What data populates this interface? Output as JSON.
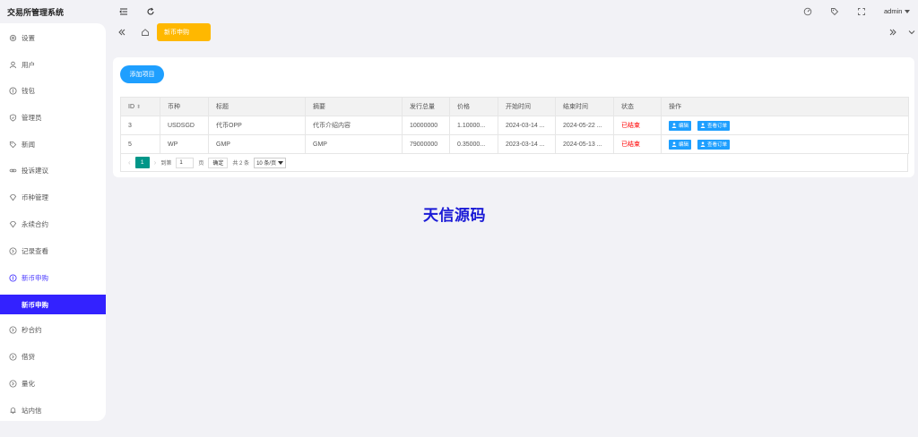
{
  "app": {
    "title": "交易所管理系统"
  },
  "sidebar": {
    "items": [
      {
        "label": "设置",
        "icon": "gear-icon"
      },
      {
        "label": "用户",
        "icon": "user-icon"
      },
      {
        "label": "钱包",
        "icon": "coin-icon"
      },
      {
        "label": "管理员",
        "icon": "shield-icon"
      },
      {
        "label": "新闻",
        "icon": "tag-icon"
      },
      {
        "label": "投诉建议",
        "icon": "link-icon"
      },
      {
        "label": "币种管理",
        "icon": "diamond-icon"
      },
      {
        "label": "永续合约",
        "icon": "diamond-icon"
      },
      {
        "label": "记录查看",
        "icon": "circle-arrow-icon"
      },
      {
        "label": "新币申购",
        "icon": "coin-icon"
      },
      {
        "label": "秒合约",
        "icon": "circle-arrow-icon"
      },
      {
        "label": "借贷",
        "icon": "circle-arrow-icon"
      },
      {
        "label": "量化",
        "icon": "circle-arrow-icon"
      },
      {
        "label": "站内信",
        "icon": "bell-icon"
      }
    ],
    "sub_active": "新币申购"
  },
  "header": {
    "user": "admin"
  },
  "tabs": {
    "active": "新币申购"
  },
  "toolbar": {
    "add_label": "添加项目"
  },
  "table": {
    "columns": [
      "ID",
      "币种",
      "标题",
      "摘要",
      "发行总量",
      "价格",
      "开始时间",
      "结束时间",
      "状态",
      "操作"
    ],
    "rows": [
      {
        "id": "3",
        "coin": "USDSGD",
        "title": "代币OPP",
        "summary": "代币介绍内容",
        "total": "10000000",
        "price": "1.10000...",
        "start": "2024-03-14 ...",
        "end": "2024-05-22 ...",
        "status": "已结束"
      },
      {
        "id": "5",
        "coin": "WP",
        "title": "GMP",
        "summary": "GMP",
        "total": "79000000",
        "price": "0.35000...",
        "start": "2023-03-14 ...",
        "end": "2024-05-13 ...",
        "status": "已结束"
      }
    ],
    "actions": {
      "edit": "编辑",
      "orders": "查看订单"
    }
  },
  "pager": {
    "current": "1",
    "goto_label": "到第",
    "page_input": "1",
    "page_unit": "页",
    "confirm": "确定",
    "total": "共 2 条",
    "per_page": "10 条/页"
  },
  "watermark": "天信源码",
  "colors": {
    "accent": "#3322ff",
    "primary": "#1e9fff",
    "tab": "#ffb800",
    "page": "#009688",
    "danger": "#ff0000"
  }
}
